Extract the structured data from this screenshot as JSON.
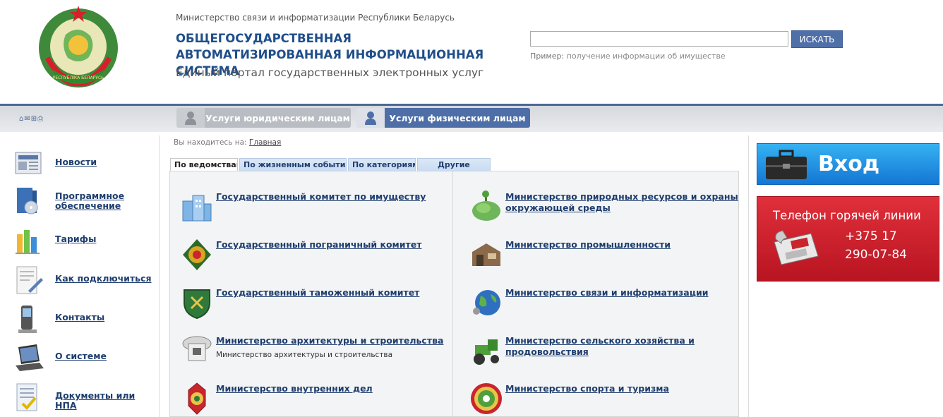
{
  "header": {
    "ministry": "Министерство связи и информатизации Республики Беларусь",
    "title": "ОБЩЕГОСУДАРСТВЕННАЯ АВТОМАТИЗИРОВАННАЯ ИНФОРМАЦИОННАЯ СИСТЕМА",
    "subtitle": "Единый портал государственных электронных услуг",
    "emblem_text": "РЕСПУБЛІКА БЕЛАРУСЬ",
    "search_placeholder": "",
    "search_button": "ИСКАТЬ",
    "example_label": "Пример:",
    "example_text": "получение информации об имуществе"
  },
  "nav": {
    "tools": "⌂✉⊞⎙",
    "legal_label": "Услуги юридическим лицам",
    "physical_label": "Услуги физическим лицам"
  },
  "sidebar": {
    "items": [
      {
        "label": "Новости",
        "icon": "newspaper-icon"
      },
      {
        "label": "Программное обеспечение",
        "icon": "software-box-icon"
      },
      {
        "label": "Тарифы",
        "icon": "bar-chart-icon"
      },
      {
        "label": "Как подключиться",
        "icon": "document-pen-icon"
      },
      {
        "label": "Контакты",
        "icon": "phone-icon"
      },
      {
        "label": "О системе",
        "icon": "laptop-icon"
      },
      {
        "label": "Документы или НПА",
        "icon": "checklist-icon"
      }
    ]
  },
  "main": {
    "breadcrumb_prefix": "Вы находитесь на:",
    "breadcrumb_link": "Главная",
    "tabs": [
      {
        "label": "По ведомствам"
      },
      {
        "label": "По жизненным событиям"
      },
      {
        "label": "По категориям"
      },
      {
        "label": "Другие"
      }
    ],
    "orgs_left": [
      {
        "name": "Государственный комитет по имуществу",
        "desc": "",
        "icon": "buildings-icon"
      },
      {
        "name": "Государственный пограничный комитет",
        "desc": "",
        "icon": "border-emblem-icon"
      },
      {
        "name": "Государственный таможенный комитет",
        "desc": "",
        "icon": "customs-shield-icon"
      },
      {
        "name": "Министерство архитектуры и строительства",
        "desc": "Министерство архитектуры и строительства",
        "icon": "architecture-emblem-icon"
      },
      {
        "name": "Министерство внутренних дел",
        "desc": "",
        "icon": "police-emblem-icon"
      }
    ],
    "orgs_right": [
      {
        "name": "Министерство природных ресурсов и охраны окружающей среды",
        "icon": "nature-icon"
      },
      {
        "name": "Министерство промышленности",
        "icon": "industry-icon"
      },
      {
        "name": "Министерство связи и информатизации",
        "icon": "globe-icon"
      },
      {
        "name": "Министерство сельского хозяйства и продовольствия",
        "icon": "tractor-icon"
      },
      {
        "name": "Министерство спорта и туризма",
        "icon": "sport-emblem-icon"
      }
    ]
  },
  "right": {
    "login_label": "Вход",
    "hotline_title": "Телефон горячей линии",
    "hotline_number_1": "+375 17",
    "hotline_number_2": "290-07-84"
  },
  "colors": {
    "brand_blue": "#1f4e8a",
    "nav_active": "#4d6ea6",
    "login_blue": "#1a86de",
    "hotline_red": "#c81d2a"
  }
}
